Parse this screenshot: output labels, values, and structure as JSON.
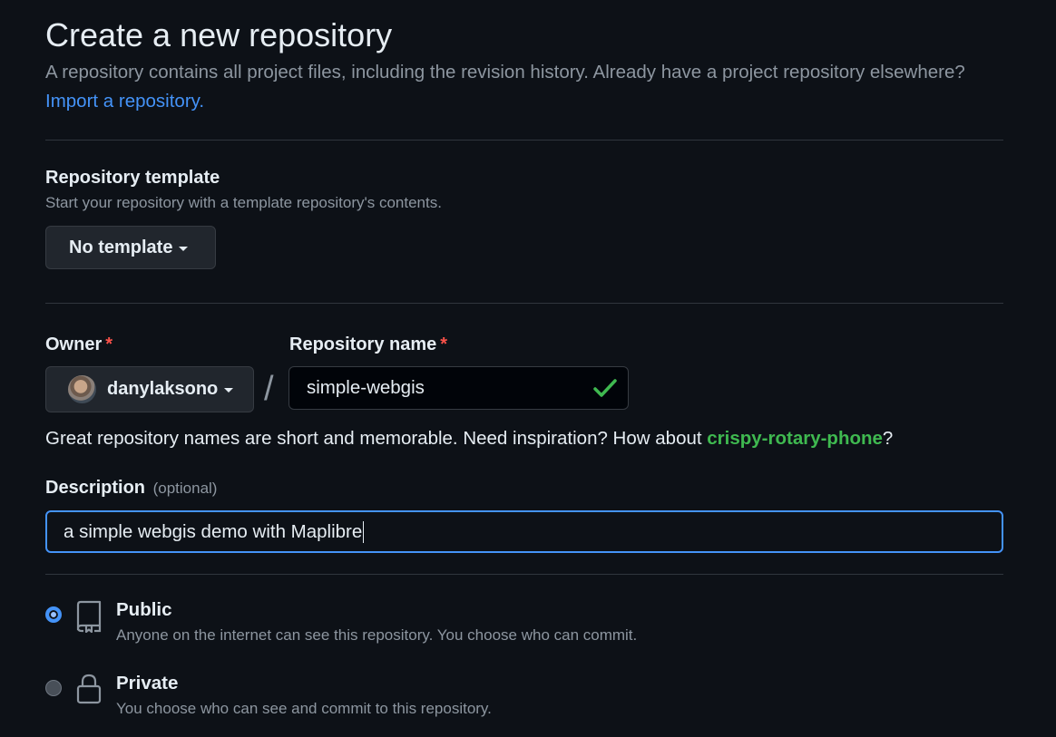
{
  "header": {
    "title": "Create a new repository",
    "subtitle": "A repository contains all project files, including the revision history. Already have a project repository elsewhere?",
    "import_link": "Import a repository."
  },
  "template_section": {
    "heading": "Repository template",
    "note": "Start your repository with a template repository's contents.",
    "button_label": "No template"
  },
  "owner": {
    "label": "Owner",
    "required_mark": "*",
    "value": "danylaksono"
  },
  "separator": "/",
  "repo_name": {
    "label": "Repository name",
    "required_mark": "*",
    "value": "simple-webgis",
    "valid": true
  },
  "name_hint": {
    "text": "Great repository names are short and memorable. Need inspiration? How about ",
    "suggestion": "crispy-rotary-phone",
    "suffix": "?"
  },
  "description": {
    "label": "Description",
    "optional_label": "(optional)",
    "value": "a simple webgis demo with Maplibre"
  },
  "visibility": {
    "options": [
      {
        "title": "Public",
        "description": "Anyone on the internet can see this repository. You choose who can commit.",
        "icon": "repo-icon",
        "selected": true
      },
      {
        "title": "Private",
        "description": "You choose who can see and commit to this repository.",
        "icon": "lock-icon",
        "selected": false
      }
    ]
  },
  "colors": {
    "background": "#0d1117",
    "link": "#4493f8",
    "success": "#3fb950",
    "danger": "#f85149",
    "muted": "#8d96a0"
  }
}
